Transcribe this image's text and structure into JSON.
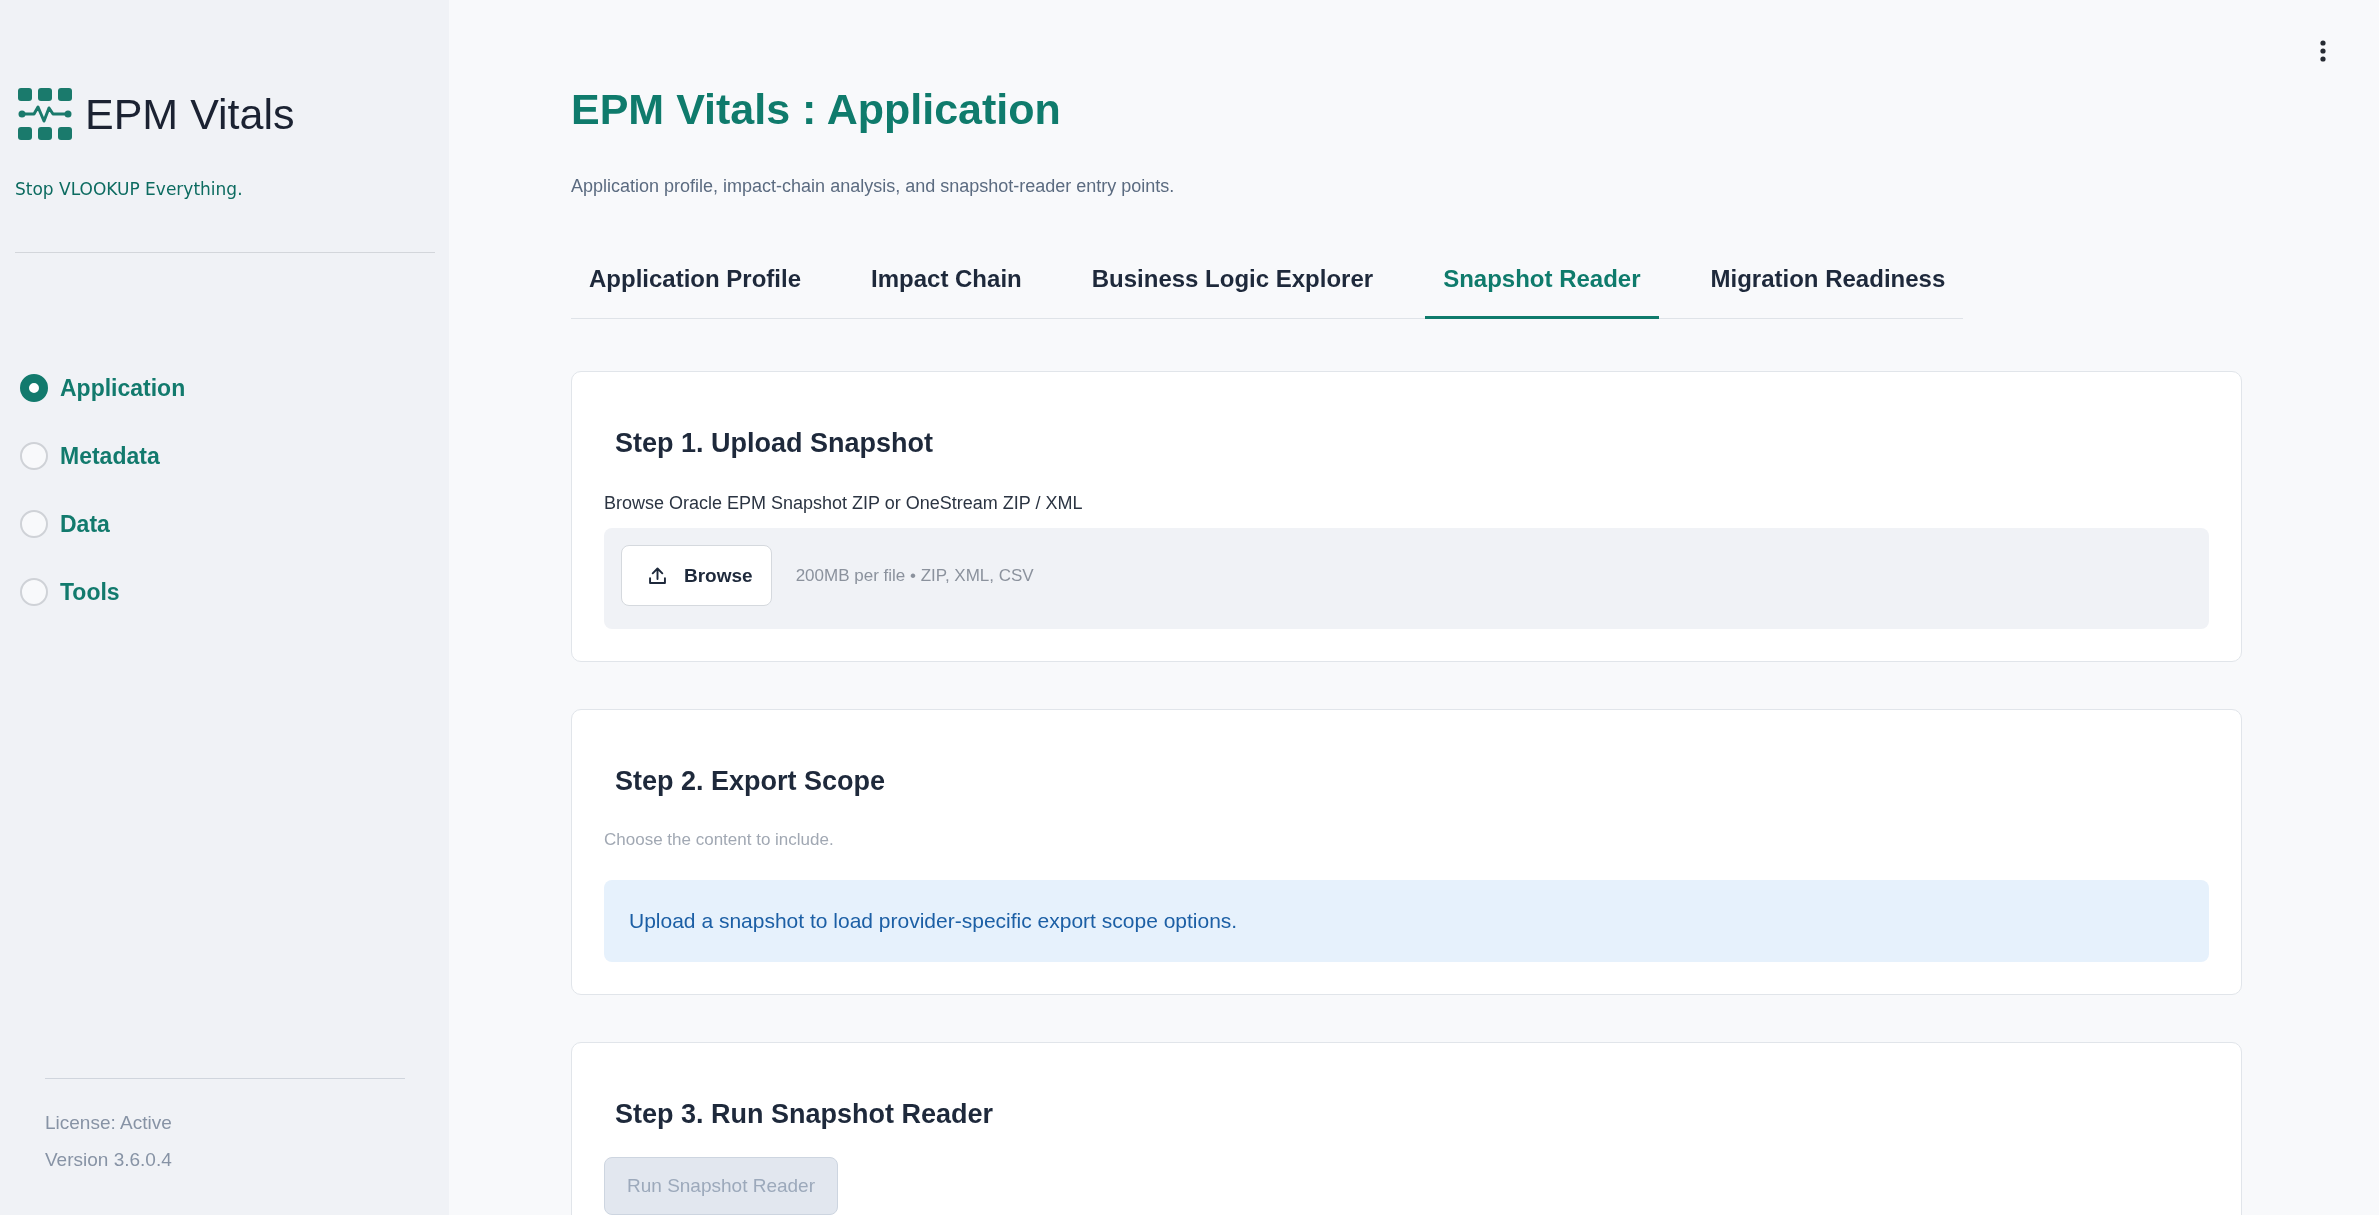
{
  "sidebar": {
    "logo_text": "EPM Vitals",
    "tagline": "Stop VLOOKUP Everything.",
    "nav": [
      {
        "label": "Application",
        "selected": true
      },
      {
        "label": "Metadata",
        "selected": false
      },
      {
        "label": "Data",
        "selected": false
      },
      {
        "label": "Tools",
        "selected": false
      }
    ],
    "footer": [
      "License: Active",
      "Version 3.6.0.4"
    ]
  },
  "header": {
    "title": "EPM Vitals : Application",
    "subtitle": "Application profile, impact-chain analysis, and snapshot-reader entry points."
  },
  "tabs": [
    {
      "label": "Application Profile",
      "selected": false
    },
    {
      "label": "Impact Chain",
      "selected": false
    },
    {
      "label": "Business Logic Explorer",
      "selected": false
    },
    {
      "label": "Snapshot Reader",
      "selected": true
    },
    {
      "label": "Migration Readiness",
      "selected": false
    }
  ],
  "steps": [
    {
      "kind": "upload",
      "title": "Step 1. Upload Snapshot",
      "label": "Browse Oracle EPM Snapshot ZIP or OneStream ZIP / XML",
      "button": "Browse",
      "hint": "200MB per file • ZIP, XML, CSV"
    },
    {
      "kind": "info",
      "title": "Step 2. Export Scope",
      "caption": "Choose the content to include.",
      "message": "Upload a snapshot to load provider-specific export scope options."
    },
    {
      "kind": "action",
      "title": "Step 3. Run Snapshot Reader",
      "button": {
        "label": "Run Snapshot Reader",
        "disabled": true
      }
    }
  ]
}
